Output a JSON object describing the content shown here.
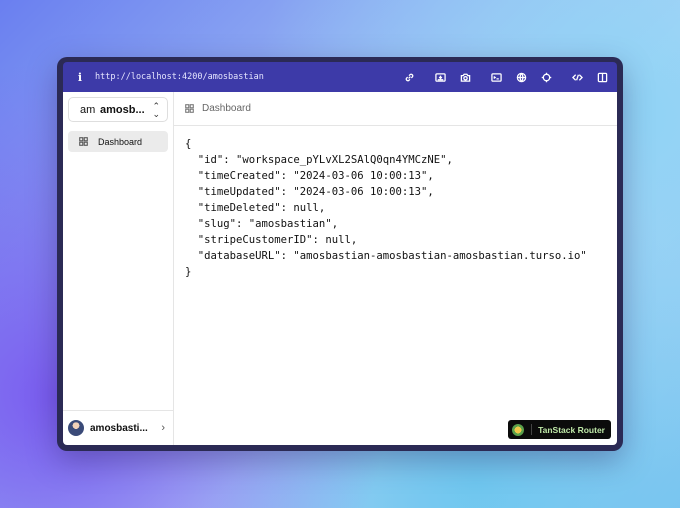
{
  "browser": {
    "info_glyph": "i",
    "url": "http://localhost:4200/amosbastian",
    "tools": [
      "link-icon",
      "screenshot-icon",
      "camera-icon",
      "terminal-icon",
      "globe-icon",
      "crosshair-icon",
      "code-icon",
      "split-view-icon"
    ]
  },
  "sidebar": {
    "workspace": {
      "abbr": "am",
      "name": "amosb..."
    },
    "items": [
      {
        "label": "Dashboard",
        "active": true
      }
    ],
    "user": {
      "name": "amosbasti..."
    }
  },
  "main": {
    "breadcrumb": "Dashboard",
    "json_text": "{\n  \"id\": \"workspace_pYLvXL2SAlQ0qn4YMCzNE\",\n  \"timeCreated\": \"2024-03-06 10:00:13\",\n  \"timeUpdated\": \"2024-03-06 10:00:13\",\n  \"timeDeleted\": null,\n  \"slug\": \"amosbastian\",\n  \"stripeCustomerID\": null,\n  \"databaseURL\": \"amosbastian-amosbastian-amosbastian.turso.io\"\n}"
  },
  "devtools": {
    "label": "TanStack Router"
  },
  "colors": {
    "titlebar": "#3d3aa8",
    "window_frame": "#2b2a55",
    "devtools_text": "#bfe8a8"
  }
}
